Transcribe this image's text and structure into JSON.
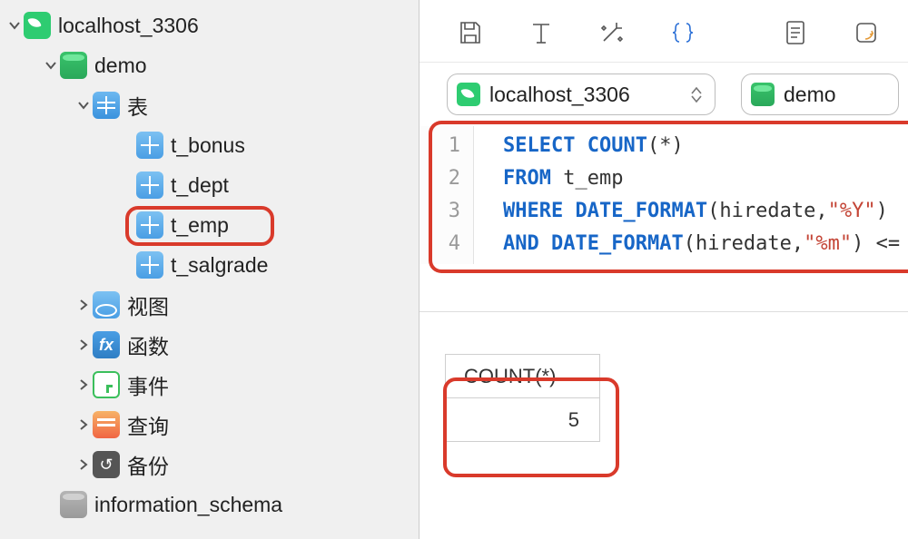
{
  "connection": {
    "name": "localhost_3306"
  },
  "databases": {
    "demo": {
      "name": "demo",
      "groups": {
        "tables": {
          "label": "表",
          "items": [
            "t_bonus",
            "t_dept",
            "t_emp",
            "t_salgrade"
          ]
        },
        "views": {
          "label": "视图"
        },
        "functions": {
          "label": "函数"
        },
        "events": {
          "label": "事件"
        },
        "queries": {
          "label": "查询"
        },
        "backups": {
          "label": "备份"
        }
      }
    },
    "information_schema": {
      "name": "information_schema"
    }
  },
  "selector": {
    "connection": "localhost_3306",
    "database": "demo"
  },
  "sql": {
    "lines": [
      {
        "n": "1",
        "tokens": [
          [
            "kw",
            "SELECT"
          ],
          [
            "sp",
            " "
          ],
          [
            "fn",
            "COUNT"
          ],
          [
            "txt",
            "(*)"
          ]
        ]
      },
      {
        "n": "2",
        "tokens": [
          [
            "kw",
            "FROM"
          ],
          [
            "sp",
            " "
          ],
          [
            "txt",
            "t_emp"
          ]
        ]
      },
      {
        "n": "3",
        "tokens": [
          [
            "kw",
            "WHERE"
          ],
          [
            "sp",
            " "
          ],
          [
            "fn",
            "DATE_FORMAT"
          ],
          [
            "txt",
            "(hiredate,"
          ],
          [
            "str",
            "\"%Y\""
          ],
          [
            "txt",
            ")"
          ]
        ]
      },
      {
        "n": "4",
        "tokens": [
          [
            "kw",
            "AND"
          ],
          [
            "sp",
            " "
          ],
          [
            "fn",
            "DATE_FORMAT"
          ],
          [
            "txt",
            "(hiredate,"
          ],
          [
            "str",
            "\"%m\""
          ],
          [
            "txt",
            ") <="
          ]
        ]
      }
    ]
  },
  "result": {
    "column": "COUNT(*)",
    "value": "5"
  },
  "icons": {
    "fx": "fx",
    "backup": "↺"
  }
}
